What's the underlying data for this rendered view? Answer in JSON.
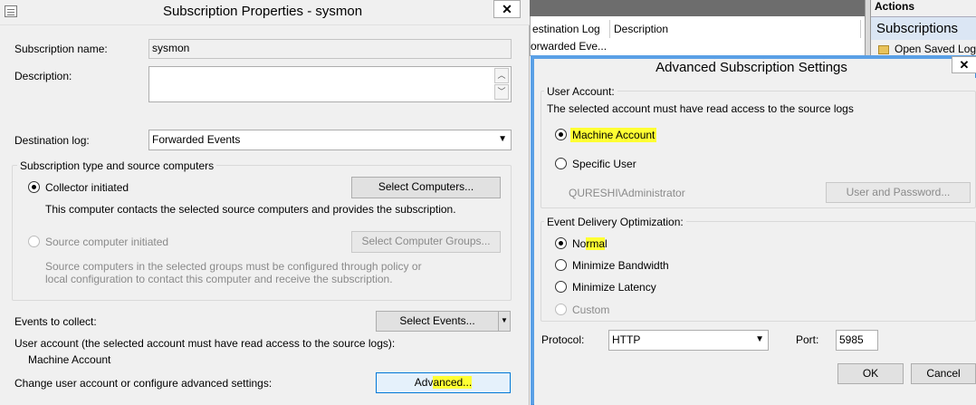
{
  "background_window": {
    "columns": [
      "estination Log",
      "Description"
    ],
    "row_value": "orwarded Eve...",
    "actions_title": "Actions",
    "actions_section": "Subscriptions",
    "actions_item": "Open Saved Log"
  },
  "subscription_dialog": {
    "title": "Subscription Properties - sysmon",
    "close": "✕",
    "subscription_name_label": "Subscription name:",
    "subscription_name_value": "sysmon",
    "description_label": "Description:",
    "description_value": "",
    "destination_log_label": "Destination log:",
    "destination_log_value": "Forwarded Events",
    "group_title": "Subscription type and source computers",
    "collector_initiated_label": "Collector initiated",
    "collector_initiated_selected": true,
    "select_computers_button": "Select Computers...",
    "collector_description": "This computer contacts the selected source computers and provides the subscription.",
    "source_initiated_label": "Source computer initiated",
    "select_computer_groups_button": "Select Computer Groups...",
    "source_description_line1": "Source computers in the selected groups must be configured through policy or",
    "source_description_line2": "local configuration to contact this computer and receive the subscription.",
    "events_to_collect_label": "Events to collect:",
    "select_events_button": "Select Events...",
    "user_account_label": "User account (the selected account must have read access to the source logs):",
    "user_account_value": "Machine Account",
    "change_user_label": "Change user account or configure advanced settings:",
    "advanced_button_pre": "Adv",
    "advanced_button_hl": "anced...",
    "highlight_color": "#ffff33"
  },
  "advanced_dialog": {
    "title": "Advanced Subscription Settings",
    "close": "✕",
    "user_account_group": "User Account:",
    "user_account_note": "The selected account must have read access to the source logs",
    "machine_account_label": "Machine Account",
    "machine_account_selected": true,
    "specific_user_label": "Specific User",
    "specific_user_value": "QURESHI\\Administrator",
    "user_password_button": "User and Password...",
    "delivery_group": "Event Delivery Optimization:",
    "normal_pre": "No",
    "normal_hl": "rma",
    "normal_post": "l",
    "normal_selected": true,
    "minimize_bandwidth_label": "Minimize Bandwidth",
    "minimize_latency_label": "Minimize Latency",
    "custom_label": "Custom",
    "protocol_label": "Protocol:",
    "protocol_value": "HTTP",
    "port_label": "Port:",
    "port_value": "5985",
    "ok_button": "OK",
    "cancel_button": "Cancel"
  }
}
